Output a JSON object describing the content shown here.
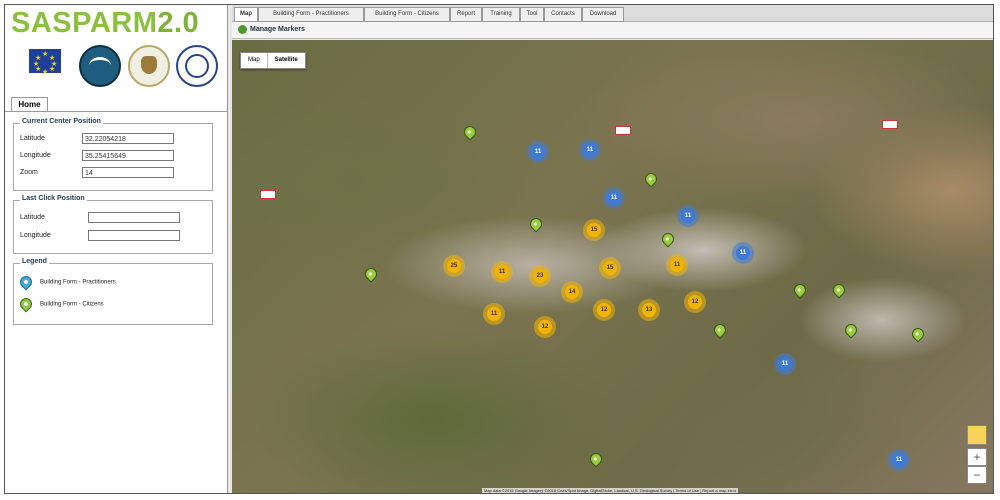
{
  "app": {
    "title": "SASPARM2.0",
    "title_main": "SASPARM",
    "title_version": "2.0",
    "brand_color": "#8bbf3d"
  },
  "logos": [
    {
      "name": "eu-flag-logo",
      "caption": ""
    },
    {
      "name": "wave-logo"
    },
    {
      "name": "eagle-seal-logo"
    },
    {
      "name": "blue-seal-logo"
    }
  ],
  "sidebar": {
    "home_tab": "Home",
    "current_center": {
      "legend": "Current Center Position",
      "rows": [
        {
          "label": "Latitude",
          "value": "32.22054218"
        },
        {
          "label": "Longitude",
          "value": "35.25415649"
        },
        {
          "label": "Zoom",
          "value": "14"
        }
      ]
    },
    "last_click": {
      "legend": "Last Click Position",
      "rows": [
        {
          "label": "Latitude",
          "value": ""
        },
        {
          "label": "Longitude",
          "value": ""
        }
      ]
    },
    "legend": {
      "title": "Legend",
      "items": [
        {
          "icon": "blue-pin-icon",
          "label": "Building Form - Practitioners",
          "color": "#4aa7d8"
        },
        {
          "icon": "green-pin-icon",
          "label": "Building Form - Citizens",
          "color": "#8ec641"
        }
      ]
    }
  },
  "topnav": {
    "tabs": [
      "Map",
      "Building Form - Practitioners",
      "Building Form - Citizens",
      "Report",
      "Training",
      "Tool",
      "Contacts",
      "Download"
    ]
  },
  "subbar": {
    "label": "Manage Markers"
  },
  "map": {
    "type_buttons": [
      "Map",
      "Satellite"
    ],
    "selected_type": "Satellite",
    "zoom_in": "+",
    "zoom_out": "−",
    "yellow_clusters": [
      "25",
      "11",
      "23",
      "15",
      "15",
      "14",
      "12",
      "13",
      "12",
      "11",
      "12",
      "11"
    ],
    "blue_clusters": [
      "11",
      "11",
      "11",
      "11",
      "11",
      "11",
      "11"
    ],
    "green_pin_count": 14,
    "cluster_colors": {
      "yellow": "#f1b300",
      "blue": "#3e7bd8",
      "green": "#9ccc3d"
    },
    "attribution": "Map data ©2015 Google Imagery ©2015 Cnes/Spot Image, DigitalGlobe, Landsat, U.S. Geological Survey | Terms of Use | Report a map error"
  }
}
